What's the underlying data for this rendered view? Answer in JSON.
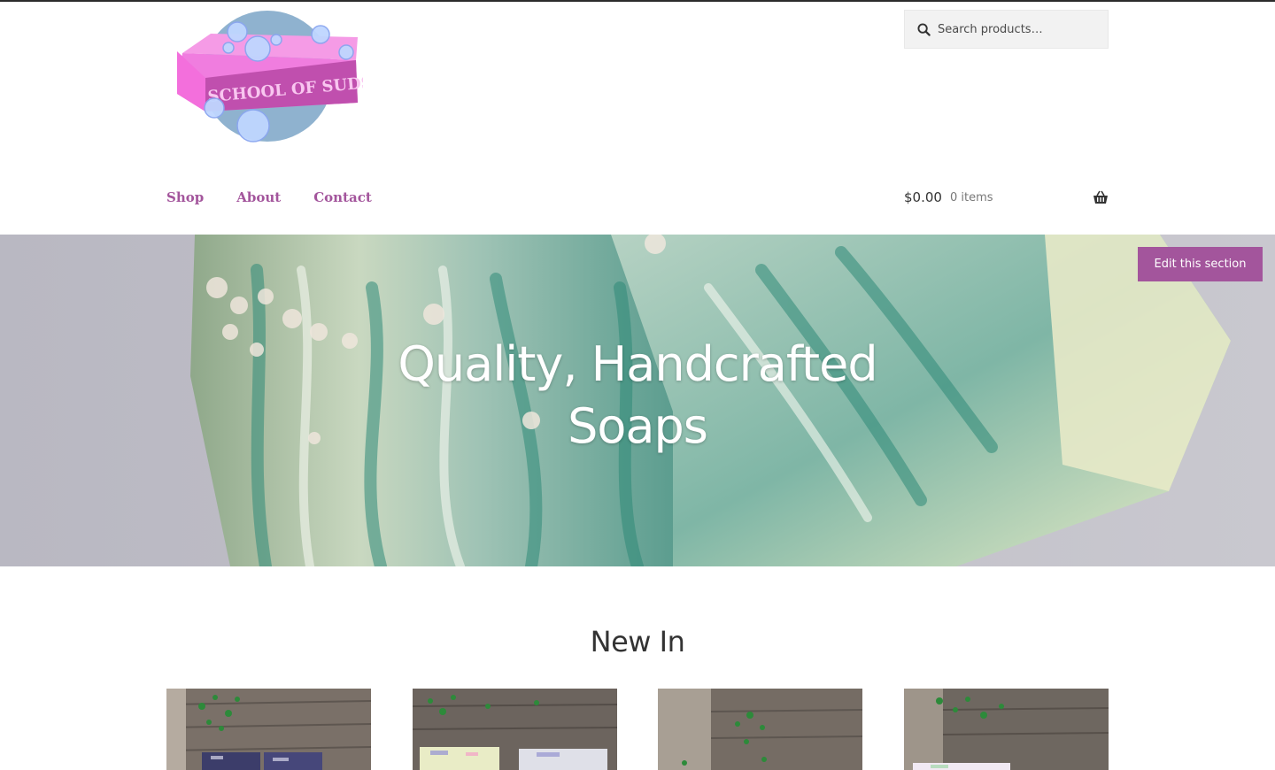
{
  "brand": {
    "logo_text": "SCHOOL OF SUDS",
    "colors": {
      "accent": "#a3559c",
      "soap_pink": "#f07ddf",
      "soap_side": "#c04fae",
      "circle": "#8fb2cf"
    }
  },
  "search": {
    "placeholder": "Search products…",
    "icon": "search-icon"
  },
  "nav": {
    "items": [
      {
        "label": "Shop"
      },
      {
        "label": "About"
      },
      {
        "label": "Contact"
      }
    ]
  },
  "cart": {
    "amount": "$0.00",
    "count": "0 items",
    "icon": "basket-icon"
  },
  "hero": {
    "title_line1": "Quality, Handcrafted",
    "title_line2": "Soaps",
    "edit_label": "Edit this section"
  },
  "new_in": {
    "title": "New In",
    "product_count": 4
  }
}
